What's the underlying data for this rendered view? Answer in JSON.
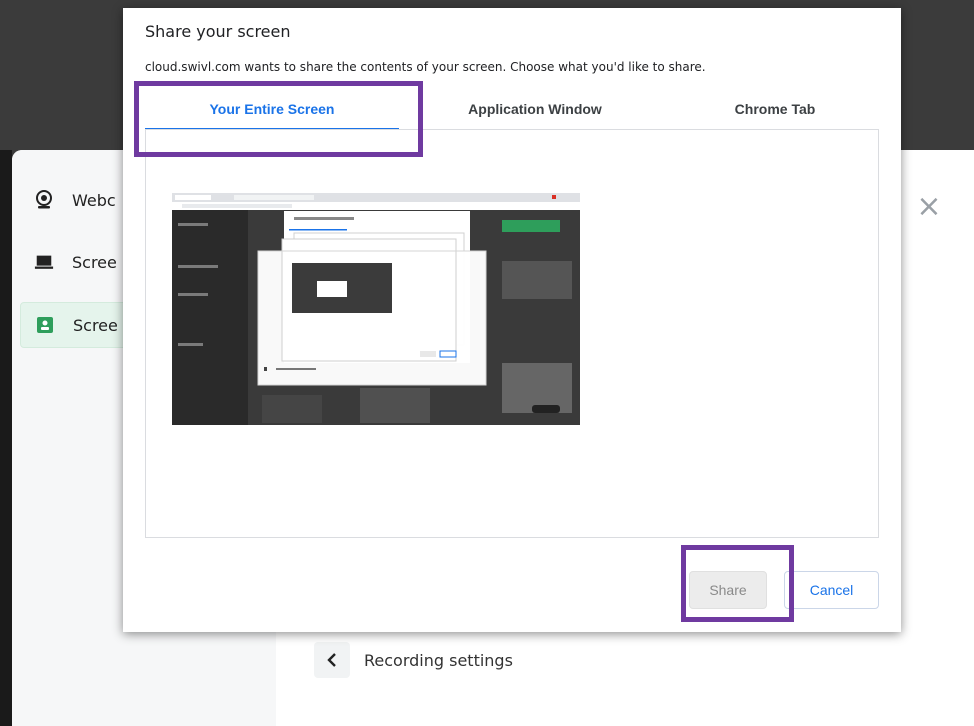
{
  "background_app": {
    "sidebar_items": [
      {
        "label": "Webc",
        "icon": "webcam-icon"
      },
      {
        "label": "Scree",
        "icon": "laptop-icon"
      },
      {
        "label": "Scree",
        "icon": "screen-share-icon",
        "active": true
      }
    ],
    "recording_settings_label": "Recording settings",
    "close_symbol": "×"
  },
  "dialog": {
    "title": "Share your screen",
    "subtitle": "cloud.swivl.com wants to share the contents of your screen. Choose what you'd like to share.",
    "tabs": [
      {
        "label": "Your Entire Screen",
        "active": true
      },
      {
        "label": "Application Window",
        "active": false
      },
      {
        "label": "Chrome Tab",
        "active": false
      }
    ],
    "share_label": "Share",
    "cancel_label": "Cancel",
    "share_enabled": false
  },
  "colors": {
    "highlight": "#6f3aa0",
    "accent_blue": "#1a73e8",
    "active_item_green": "#e5f4ec"
  }
}
